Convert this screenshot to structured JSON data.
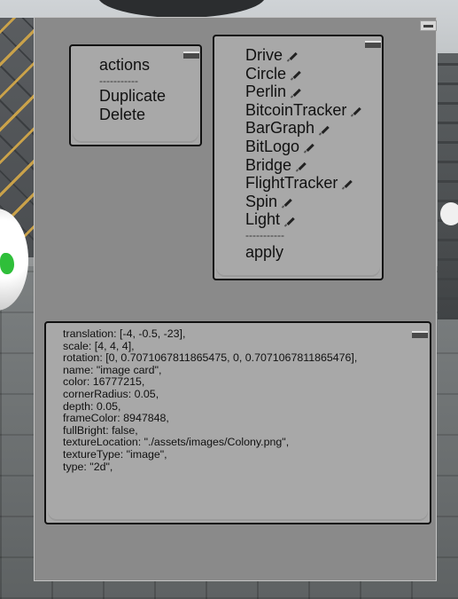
{
  "actions_menu": {
    "title": "actions",
    "separator": "-----------",
    "items": [
      "Duplicate",
      "Delete"
    ]
  },
  "behaviors_menu": {
    "items": [
      "Drive",
      "Circle",
      "Perlin",
      "BitcoinTracker",
      "BarGraph",
      "BitLogo",
      "Bridge",
      "FlightTracker",
      "Spin",
      "Light"
    ],
    "separator": "-----------",
    "apply_label": "apply"
  },
  "properties": {
    "lines": [
      "translation: [-4, -0.5, -23],",
      "scale: [4, 4, 4],",
      "rotation: [0, 0.7071067811865475, 0, 0.7071067811865476],",
      "name: \"image card\",",
      "color: 16777215,",
      "cornerRadius: 0.05,",
      "depth: 0.05,",
      "frameColor: 8947848,",
      "fullBright: false,",
      "textureLocation: \"./assets/images/Colony.png\",",
      "textureType: \"image\",",
      "type: \"2d\","
    ]
  },
  "icons": {
    "minimize": "minimize-icon",
    "edit": "pencil-icon"
  },
  "colors": {
    "panel_bg": "#8a8a8a",
    "box_bg": "#a8a8a8",
    "border": "#111111"
  }
}
